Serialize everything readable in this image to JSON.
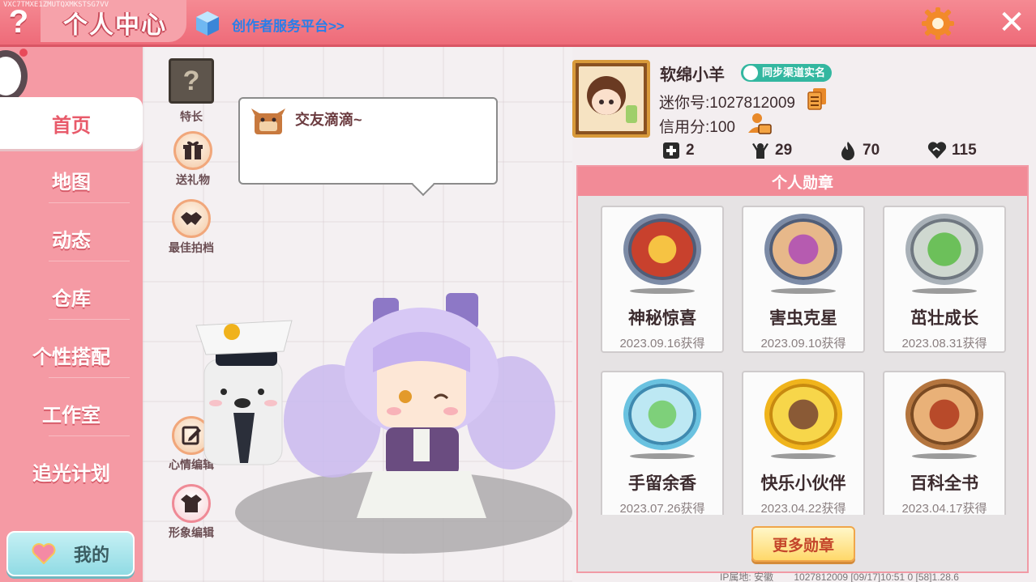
{
  "topbar": {
    "version_text": "VXC7TMXE1ZMUTQXMKSTSG7VV",
    "title": "个人中心",
    "creator_link": "创作者服务平台>>",
    "help_label": "?",
    "close_label": "✕"
  },
  "sidebar": {
    "items": [
      {
        "label": "首页",
        "active": true
      },
      {
        "label": "地图"
      },
      {
        "label": "动态"
      },
      {
        "label": "仓库"
      },
      {
        "label": "个性搭配"
      },
      {
        "label": "工作室"
      },
      {
        "label": "追光计划"
      }
    ],
    "mine_label": "我的"
  },
  "actions": {
    "specialty": "特长",
    "send_gift": "送礼物",
    "best_partner": "最佳拍档",
    "mood_edit": "心情编辑",
    "avatar_edit": "形象编辑",
    "mystery": "?"
  },
  "speech": {
    "text": "交友滴滴~"
  },
  "profile": {
    "nickname": "软绵小羊",
    "verify_badge": "同步渠道实名",
    "mini_id": "迷你号:1027812009",
    "credit": "信用分:100",
    "stats": [
      {
        "icon": "plus-square-icon",
        "value": "2"
      },
      {
        "icon": "cheer-icon",
        "value": "29"
      },
      {
        "icon": "flame-icon",
        "value": "70"
      },
      {
        "icon": "heart-handshake-icon",
        "value": "115"
      }
    ]
  },
  "medals": {
    "header": "个人勋章",
    "items": [
      {
        "name": "神秘惊喜",
        "date": "2023.09.16获得",
        "color": "#c8412d"
      },
      {
        "name": "害虫克星",
        "date": "2023.09.10获得",
        "color": "#b65bb0"
      },
      {
        "name": "茁壮成长",
        "date": "2023.08.31获得",
        "color": "#4e9e48"
      },
      {
        "name": "手留余香",
        "date": "2023.07.26获得",
        "color": "#5fb7d9"
      },
      {
        "name": "快乐小伙伴",
        "date": "2023.04.22获得",
        "color": "#e8b21c"
      },
      {
        "name": "百科全书",
        "date": "2023.04.17获得",
        "color": "#c86a2c"
      }
    ],
    "more_label": "更多勋章"
  },
  "footer": {
    "ip": "IP属地: 安徽",
    "info": "1027812009   [09/17]10:51 0   [58]1.28.6"
  },
  "colors": {
    "topbar": "#ee6b79",
    "sidebar": "#f59aa4",
    "accent": "#e85a6a",
    "link": "#2a7ee8"
  }
}
